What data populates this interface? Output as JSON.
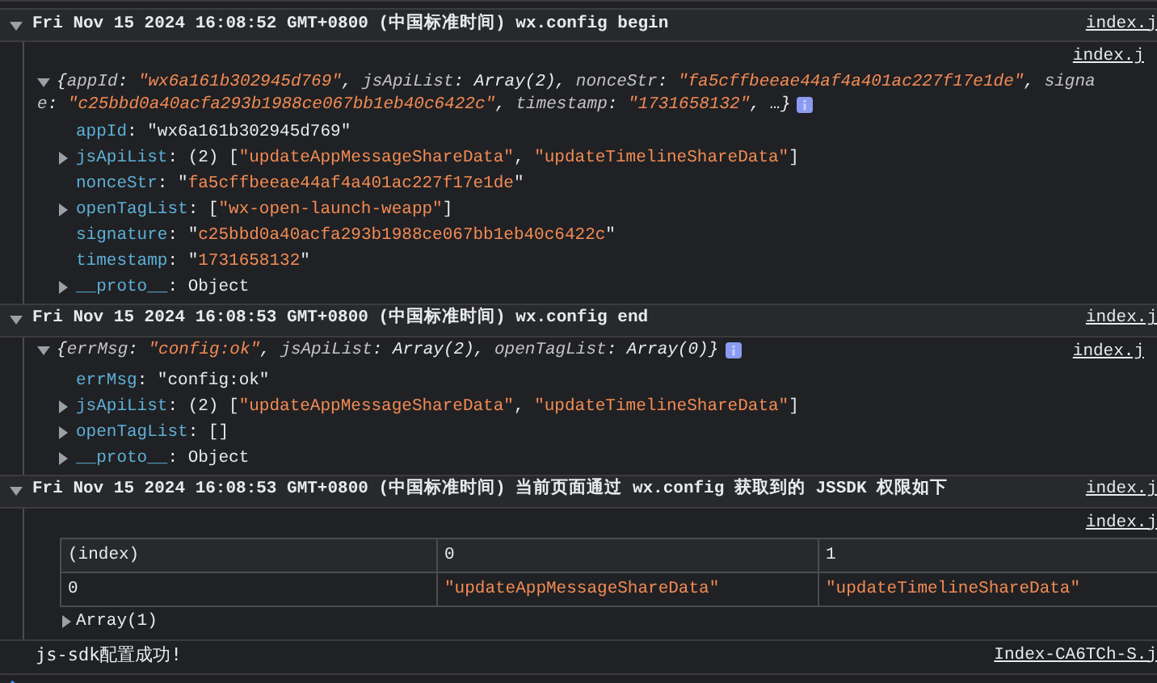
{
  "groups": [
    {
      "header": "Fri Nov 15 2024 16:08:52 GMT+0800 (中国标准时间) wx.config begin",
      "source": "index.j",
      "expanded": true,
      "entries": [
        {
          "kind": "object",
          "source": "index.j",
          "expanded": true,
          "preview": [
            [
              {
                "t": "{",
                "kind": "punct"
              },
              {
                "t": "appId",
                "kind": "pkey"
              },
              {
                "t": ": ",
                "kind": "punct"
              },
              {
                "t": "\"wx6a161b302945d769\"",
                "kind": "string"
              },
              {
                "t": ", ",
                "kind": "punct"
              },
              {
                "t": "jsApiList",
                "kind": "pkey"
              },
              {
                "t": ": Array(2), ",
                "kind": "punct"
              },
              {
                "t": "nonceStr",
                "kind": "pkey"
              },
              {
                "t": ": ",
                "kind": "punct"
              },
              {
                "t": "\"fa5cffbeeae44af4a401ac227f17e1de\"",
                "kind": "string"
              },
              {
                "t": ", ",
                "kind": "punct"
              },
              {
                "t": "signa",
                "kind": "pkey"
              }
            ],
            [
              {
                "t": "e",
                "kind": "pkey"
              },
              {
                "t": ": ",
                "kind": "punct"
              },
              {
                "t": "\"c25bbd0a40acfa293b1988ce067bb1eb40c6422c\"",
                "kind": "string"
              },
              {
                "t": ", ",
                "kind": "punct"
              },
              {
                "t": "timestamp",
                "kind": "pkey"
              },
              {
                "t": ": ",
                "kind": "punct"
              },
              {
                "t": "\"1731658132\"",
                "kind": "string"
              },
              {
                "t": ", …}",
                "kind": "punct"
              }
            ]
          ],
          "properties": [
            {
              "key": "appId",
              "value": [
                {
                  "t": ": \"wx6a161b302945d769\"",
                  "kind": "punct"
                }
              ]
            },
            {
              "key": "jsApiList",
              "expanded": false,
              "value": [
                {
                  "t": ": (2) [",
                  "kind": "punct"
                },
                {
                  "t": "\"updateAppMessageShareData\"",
                  "kind": "string"
                },
                {
                  "t": ", ",
                  "kind": "punct"
                },
                {
                  "t": "\"updateTimelineShareData\"",
                  "kind": "string"
                },
                {
                  "t": "]",
                  "kind": "punct"
                }
              ]
            },
            {
              "key": "nonceStr",
              "value": [
                {
                  "t": ": \"",
                  "kind": "punct"
                },
                {
                  "t": "fa5cffbeeae44af4a401ac227f17e1de",
                  "kind": "string"
                },
                {
                  "t": "\"",
                  "kind": "punct"
                }
              ]
            },
            {
              "key": "openTagList",
              "expanded": false,
              "value": [
                {
                  "t": ": [",
                  "kind": "punct"
                },
                {
                  "t": "\"wx-open-launch-weapp\"",
                  "kind": "string"
                },
                {
                  "t": "]",
                  "kind": "punct"
                }
              ]
            },
            {
              "key": "signature",
              "value": [
                {
                  "t": ": \"",
                  "kind": "punct"
                },
                {
                  "t": "c25bbd0a40acfa293b1988ce067bb1eb40c6422c",
                  "kind": "string"
                },
                {
                  "t": "\"",
                  "kind": "punct"
                }
              ]
            },
            {
              "key": "timestamp",
              "value": [
                {
                  "t": ": \"",
                  "kind": "punct"
                },
                {
                  "t": "1731658132",
                  "kind": "string"
                },
                {
                  "t": "\"",
                  "kind": "punct"
                }
              ]
            },
            {
              "key": "__proto__",
              "expanded": false,
              "value": [
                {
                  "t": ": Object",
                  "kind": "punct"
                }
              ]
            }
          ]
        }
      ]
    },
    {
      "header": "Fri Nov 15 2024 16:08:53 GMT+0800 (中国标准时间) wx.config end",
      "source": "index.j",
      "expanded": true,
      "entries": [
        {
          "kind": "object",
          "source": "index.j",
          "expanded": true,
          "preview": [
            [
              {
                "t": "{",
                "kind": "punct"
              },
              {
                "t": "errMsg",
                "kind": "pkey"
              },
              {
                "t": ": ",
                "kind": "punct"
              },
              {
                "t": "\"config:ok\"",
                "kind": "string"
              },
              {
                "t": ", ",
                "kind": "punct"
              },
              {
                "t": "jsApiList",
                "kind": "pkey"
              },
              {
                "t": ": Array(2), ",
                "kind": "punct"
              },
              {
                "t": "openTagList",
                "kind": "pkey"
              },
              {
                "t": ": Array(0)}",
                "kind": "punct"
              }
            ]
          ],
          "properties": [
            {
              "key": "errMsg",
              "value": [
                {
                  "t": ": \"config:ok\"",
                  "kind": "punct"
                }
              ]
            },
            {
              "key": "jsApiList",
              "expanded": false,
              "value": [
                {
                  "t": ": (2) [",
                  "kind": "punct"
                },
                {
                  "t": "\"updateAppMessageShareData\"",
                  "kind": "string"
                },
                {
                  "t": ", ",
                  "kind": "punct"
                },
                {
                  "t": "\"updateTimelineShareData\"",
                  "kind": "string"
                },
                {
                  "t": "]",
                  "kind": "punct"
                }
              ]
            },
            {
              "key": "openTagList",
              "expanded": false,
              "value": [
                {
                  "t": ": []",
                  "kind": "punct"
                }
              ]
            },
            {
              "key": "__proto__",
              "expanded": false,
              "value": [
                {
                  "t": ": Object",
                  "kind": "punct"
                }
              ]
            }
          ]
        }
      ]
    },
    {
      "header": "Fri Nov 15 2024 16:08:53 GMT+0800 (中国标准时间) 当前页面通过 wx.config 获取到的 JSSDK 权限如下",
      "source": "index.j",
      "expanded": true,
      "entries": [
        {
          "kind": "table",
          "source": "index.j",
          "columns": [
            "(index)",
            "0",
            "1"
          ],
          "rows": [
            [
              {
                "t": "0",
                "kind": "punct"
              },
              {
                "t": "\"updateAppMessageShareData\"",
                "kind": "string"
              },
              {
                "t": "\"updateTimelineShareData\"",
                "kind": "string"
              }
            ]
          ],
          "footer": {
            "label": "Array(1)",
            "expanded": false
          }
        }
      ]
    }
  ],
  "log": {
    "text": "js-sdk配置成功!",
    "source": "Index-CA6TCh-S.j"
  }
}
